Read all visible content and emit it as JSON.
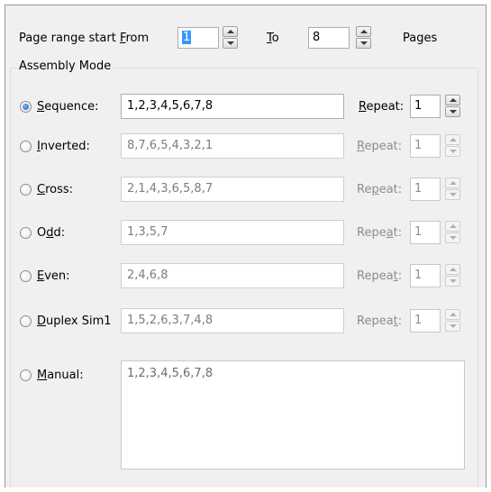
{
  "header": {
    "range_label_pre": "Page range start ",
    "from_mnemonic": "F",
    "from_rest": "rom",
    "from_value": "1",
    "to_mnemonic": "T",
    "to_rest": "o",
    "to_value": "8",
    "pages_label": "Pages"
  },
  "group": {
    "title": "Assembly Mode"
  },
  "modes": [
    {
      "pre": "",
      "mn": "S",
      "post": "equence:",
      "value": "1,2,3,4,5,6,7,8",
      "repeat_pre": "",
      "repeat_mn": "R",
      "repeat_post": "epeat:",
      "repeat_value": "1",
      "checked": true,
      "enabled": true
    },
    {
      "pre": "",
      "mn": "I",
      "post": "nverted:",
      "value": "8,7,6,5,4,3,2,1",
      "repeat_pre": "",
      "repeat_mn": "R",
      "repeat_post": "epeat:",
      "repeat_value": "1",
      "checked": false,
      "enabled": false
    },
    {
      "pre": "",
      "mn": "C",
      "post": "ross:",
      "value": "2,1,4,3,6,5,8,7",
      "repeat_pre": "Re",
      "repeat_mn": "p",
      "repeat_post": "eat:",
      "repeat_value": "1",
      "checked": false,
      "enabled": false
    },
    {
      "pre": "O",
      "mn": "d",
      "post": "d:",
      "value": "1,3,5,7",
      "repeat_pre": "Repe",
      "repeat_mn": "a",
      "repeat_post": "t:",
      "repeat_value": "1",
      "checked": false,
      "enabled": false
    },
    {
      "pre": "",
      "mn": "E",
      "post": "ven:",
      "value": "2,4,6,8",
      "repeat_pre": "Repea",
      "repeat_mn": "t",
      "repeat_post": ":",
      "repeat_value": "1",
      "checked": false,
      "enabled": false
    },
    {
      "pre": "",
      "mn": "D",
      "post": "uplex Sim1",
      "value": "1,5,2,6,3,7,4,8",
      "repeat_pre": "Repea",
      "repeat_mn": "t",
      "repeat_post": ":",
      "repeat_value": "1",
      "checked": false,
      "enabled": false
    }
  ],
  "manual": {
    "pre": "",
    "mn": "M",
    "post": "anual:",
    "value": "1,2,3,4,5,6,7,8"
  }
}
